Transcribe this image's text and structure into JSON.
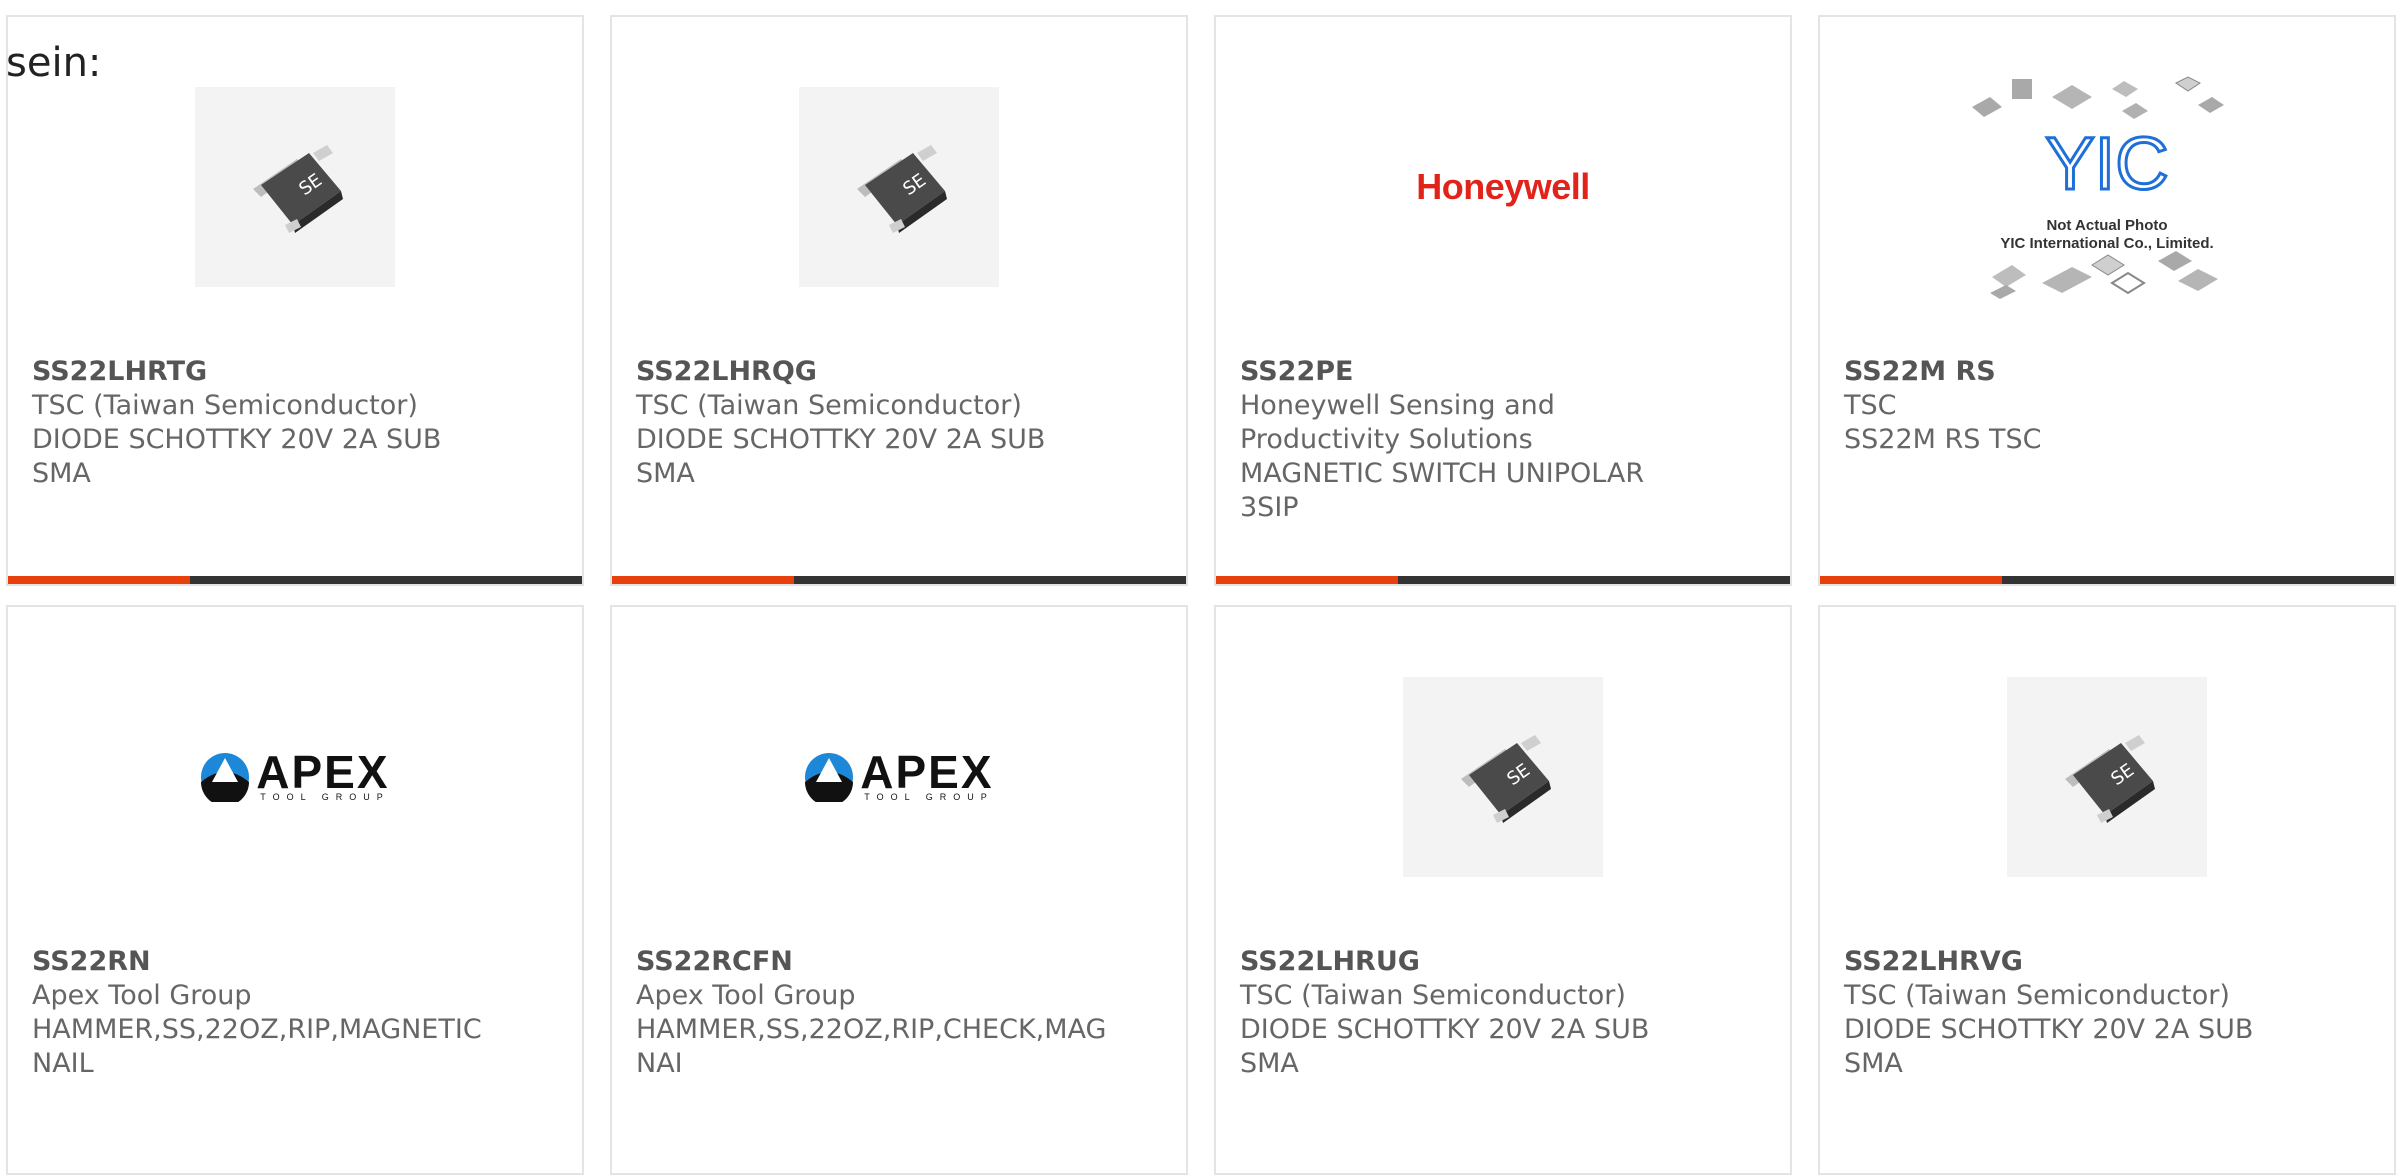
{
  "heading": "sein:",
  "colors": {
    "accent": "#e8400c",
    "bar": "#333333",
    "honeywell_red": "#e2231a",
    "apex_blue": "#1e88d8"
  },
  "products": [
    {
      "part": "SS22LHRTG",
      "lines": [
        "TSC (Taiwan Semiconductor)",
        "DIODE SCHOTTKY 20V 2A SUB",
        "SMA"
      ],
      "image": "diode-chip-icon"
    },
    {
      "part": "SS22LHRQG",
      "lines": [
        "TSC (Taiwan Semiconductor)",
        "DIODE SCHOTTKY 20V 2A SUB",
        "SMA"
      ],
      "image": "diode-chip-icon"
    },
    {
      "part": "SS22PE",
      "lines": [
        "Honeywell Sensing and",
        "Productivity Solutions",
        "MAGNETIC SWITCH UNIPOLAR",
        "3SIP"
      ],
      "image": "honeywell-logo",
      "logo_text": "Honeywell"
    },
    {
      "part": "SS22M RS",
      "lines": [
        "TSC",
        "SS22M RS TSC"
      ],
      "image": "yic-placeholder-logo",
      "logo_text": "YIC",
      "caption": [
        "Not Actual Photo",
        "YIC International Co., Limited."
      ]
    },
    {
      "part": "SS22RN",
      "lines": [
        "Apex Tool Group",
        "HAMMER,SS,22OZ,RIP,MAGNETIC",
        "NAIL"
      ],
      "image": "apex-logo",
      "logo_text": "APEX",
      "logo_sub": "TOOL GROUP"
    },
    {
      "part": "SS22RCFN",
      "lines": [
        "Apex Tool Group",
        "HAMMER,SS,22OZ,RIP,CHECK,MAG",
        "NAI"
      ],
      "image": "apex-logo",
      "logo_text": "APEX",
      "logo_sub": "TOOL GROUP"
    },
    {
      "part": "SS22LHRUG",
      "lines": [
        "TSC (Taiwan Semiconductor)",
        "DIODE SCHOTTKY 20V 2A SUB",
        "SMA"
      ],
      "image": "diode-chip-icon"
    },
    {
      "part": "SS22LHRVG",
      "lines": [
        "TSC (Taiwan Semiconductor)",
        "DIODE SCHOTTKY 20V 2A SUB",
        "SMA"
      ],
      "image": "diode-chip-icon"
    }
  ]
}
